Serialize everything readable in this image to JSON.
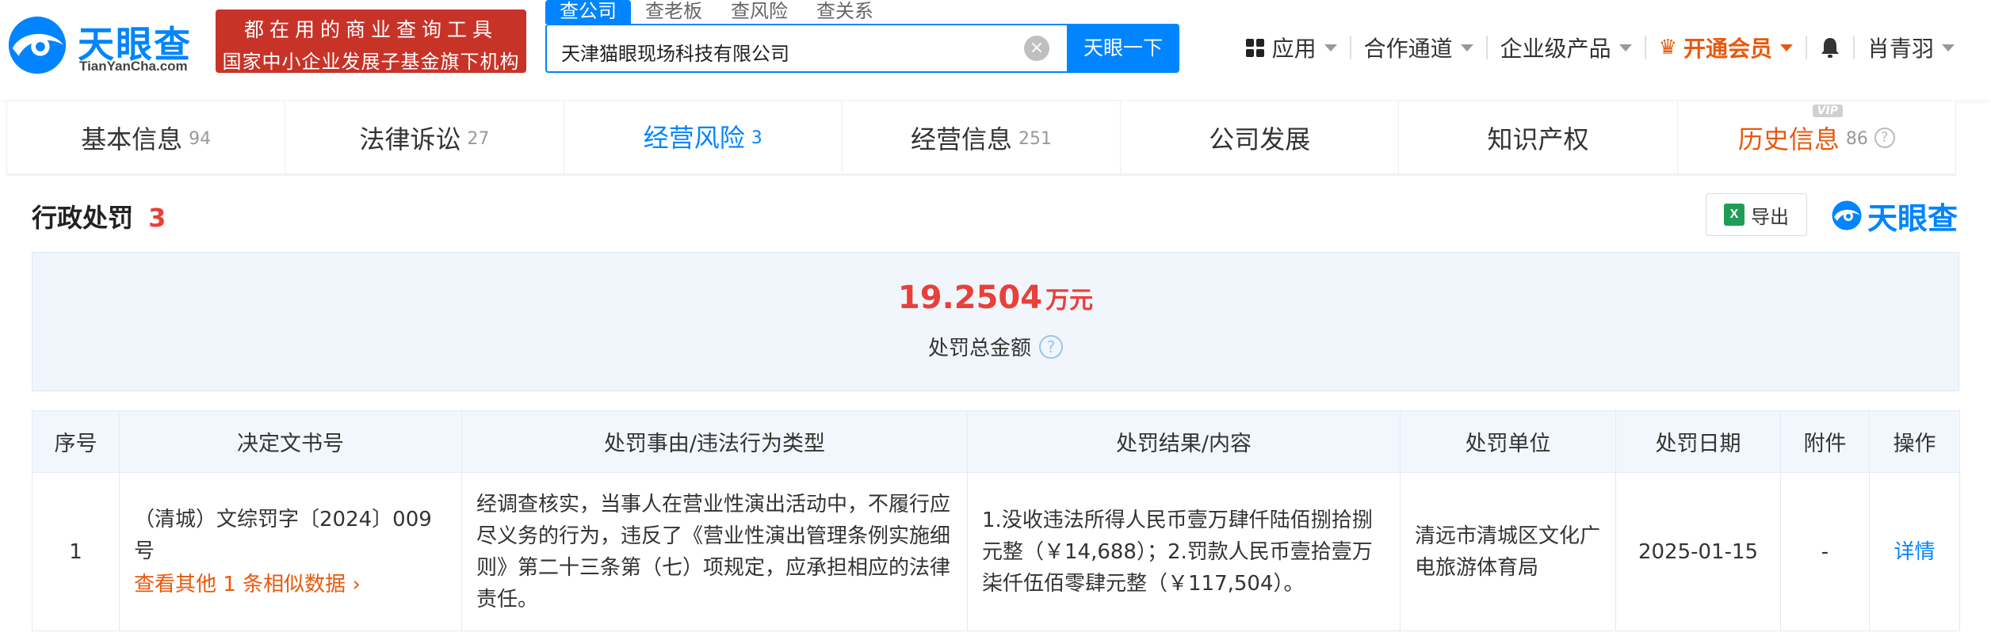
{
  "header": {
    "logo_text": "天眼查",
    "logo_sub": "TianYanCha.com",
    "promo_line1": "都在用的商业查询工具",
    "promo_line2": "国家中小企业发展子基金旗下机构",
    "search_tabs": [
      {
        "label": "查公司",
        "active": true
      },
      {
        "label": "查老板",
        "active": false
      },
      {
        "label": "查风险",
        "active": false
      },
      {
        "label": "查关系",
        "active": false
      }
    ],
    "search_value": "天津猫眼现场科技有限公司",
    "search_button": "天眼一下",
    "nav": {
      "apps": "应用",
      "partners": "合作通道",
      "enterprise": "企业级产品",
      "vip": "开通会员",
      "user": "肖青羽"
    }
  },
  "module_tabs": [
    {
      "label": "基本信息",
      "count": "94"
    },
    {
      "label": "法律诉讼",
      "count": "27"
    },
    {
      "label": "经营风险",
      "count": "3"
    },
    {
      "label": "经营信息",
      "count": "251"
    },
    {
      "label": "公司发展",
      "count": ""
    },
    {
      "label": "知识产权",
      "count": ""
    },
    {
      "label": "历史信息",
      "count": "86",
      "badge": "VIP"
    }
  ],
  "section": {
    "title": "行政处罚",
    "count": "3",
    "export_label": "导出",
    "excel_icon_letter": "X",
    "brand": "天眼查"
  },
  "summary": {
    "amount": "19.2504",
    "unit": "万元",
    "label": "处罚总金额"
  },
  "table": {
    "headers": [
      "序号",
      "决定文书号",
      "处罚事由/违法行为类型",
      "处罚结果/内容",
      "处罚单位",
      "处罚日期",
      "附件",
      "操作"
    ],
    "rows": [
      {
        "index": "1",
        "doc_no": "（清城）文综罚字〔2024〕009号",
        "similar": "查看其他 1 条相似数据",
        "reason": "经调查核实，当事人在营业性演出活动中，不履行应尽义务的行为，违反了《营业性演出管理条例实施细则》第二十三条第（七）项规定，应承担相应的法律责任。",
        "result": "1.没收违法所得人民币壹万肆仟陆佰捌拾捌元整（￥14,688）；2.罚款人民币壹拾壹万柒仟伍佰零肆元整（￥117,504）。",
        "authority": "清远市清城区文化广电旅游体育局",
        "date": "2025-01-15",
        "attachment": "-",
        "action": "详情"
      }
    ]
  },
  "colors": {
    "primary": "#0084ff",
    "accent_red": "#e8403a",
    "accent_orange": "#e8590c",
    "promo_red": "#c83328",
    "summary_bg": "#f0f6fc"
  }
}
